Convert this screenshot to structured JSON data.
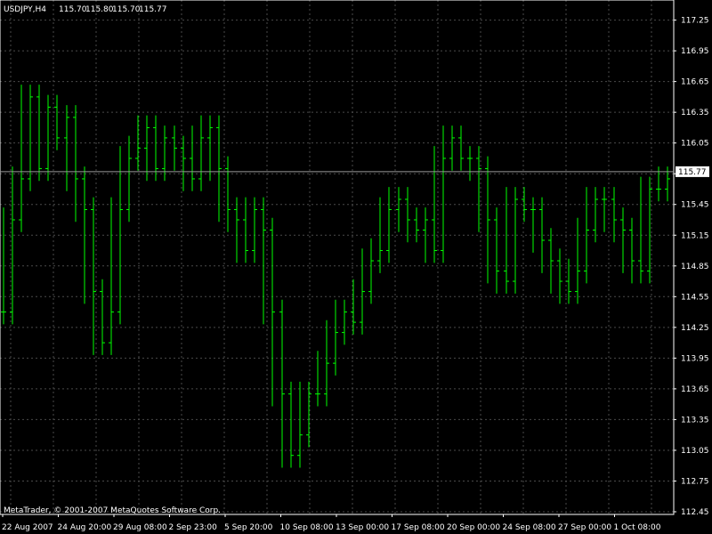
{
  "header": {
    "symbol": "USDJPY,H4",
    "ohlc": [
      "115.70",
      "115.80",
      "115.70",
      "115.77"
    ]
  },
  "copyright": "MetaTrader, © 2001-2007 MetaQuotes Software Corp.",
  "colors": {
    "background": "#000000",
    "candle": "#00ff00",
    "grid": "#4a4a4a",
    "text": "#ffffff",
    "price_line": "#9a9a9a",
    "price_box_bg": "#ffffff",
    "price_box_text": "#000000"
  },
  "chart_data": {
    "type": "line",
    "title": "USDJPY,H4",
    "ylim": [
      12.45,
      117.42
    ],
    "ylim_note_removed": true,
    "y_ticks": [
      117.25,
      116.95,
      116.65,
      116.35,
      116.05,
      115.75,
      115.45,
      115.15,
      114.85,
      114.55,
      114.25,
      113.95,
      113.65,
      113.35,
      113.05,
      112.75,
      112.45
    ],
    "y_tick_labels": [
      "117.25",
      "116.95",
      "116.65",
      "116.35",
      "116.05",
      "115.75",
      "115.45",
      "115.15",
      "114.85",
      "114.55",
      "114.25",
      "113.95",
      "113.65",
      "113.35",
      "113.05",
      "112.75",
      "112.45"
    ],
    "x_tick_labels": [
      "22 Aug 2007",
      "24 Aug 20:00",
      "29 Aug 08:00",
      "2 Sep 23:00",
      "5 Sep 20:00",
      "10 Sep 08:00",
      "13 Sep 00:00",
      "17 Sep 08:00",
      "20 Sep 00:00",
      "24 Sep 08:00",
      "27 Sep 00:00",
      "1 Oct 08:00"
    ],
    "grid": true,
    "current_price": "115.77",
    "series": [
      {
        "values": [
          114.4,
          115.3,
          115.7,
          116.5,
          115.8,
          116.4,
          116.1,
          116.3,
          115.7,
          115.4,
          114.6,
          114.1,
          114.4,
          115.4,
          115.9,
          116.0,
          116.2,
          115.8,
          116.1,
          116.0,
          115.9,
          115.7,
          116.1,
          116.2,
          115.8,
          115.4,
          115.3,
          115.0,
          115.4,
          115.2,
          114.4,
          113.6,
          113.0,
          113.2,
          113.6,
          113.6,
          113.9,
          114.2,
          114.4,
          114.3,
          114.6,
          114.9,
          115.0,
          115.4,
          115.5,
          115.3,
          115.2,
          115.3,
          115.0,
          115.9,
          116.1,
          115.9,
          115.9,
          115.8,
          115.3,
          114.8,
          114.7,
          115.5,
          115.4,
          115.4,
          115.1,
          114.9,
          114.7,
          114.6,
          114.8,
          115.2,
          115.5,
          115.5,
          115.3,
          115.2,
          114.9,
          114.8,
          115.6,
          115.6,
          115.7
        ]
      }
    ]
  }
}
